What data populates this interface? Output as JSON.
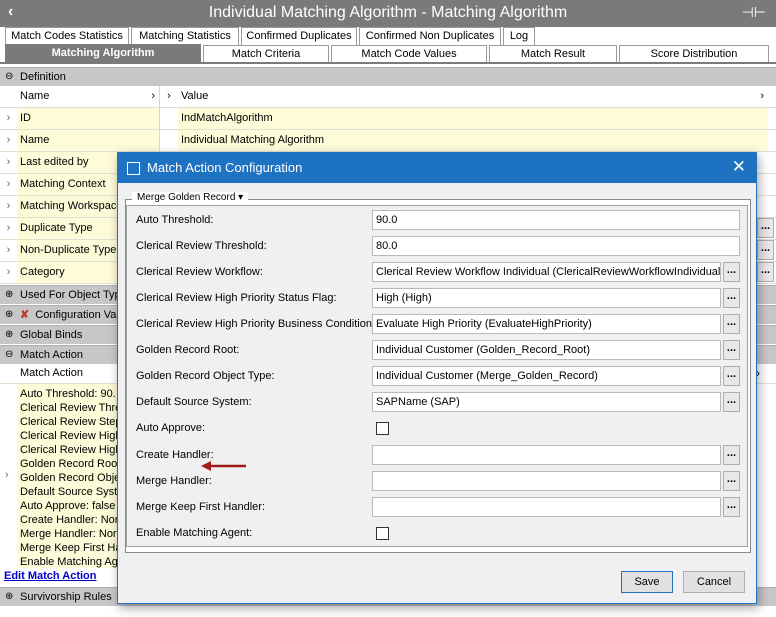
{
  "window": {
    "title": "Individual Matching Algorithm - Matching Algorithm",
    "back_icon": "‹",
    "pin_icon": "⊣⊢"
  },
  "tabs_row1": [
    "Match Codes Statistics",
    "Matching Statistics",
    "Confirmed Duplicates",
    "Confirmed Non Duplicates",
    "Log"
  ],
  "tabs_row2": [
    "Matching Algorithm",
    "Match Criteria",
    "Match Code Values",
    "Match Result",
    "Score Distribution"
  ],
  "definition": {
    "header": "Definition",
    "col_name": "Name",
    "col_value": "Value",
    "rows": [
      {
        "name": "ID",
        "value": "IndMatchAlgorithm"
      },
      {
        "name": "Name",
        "value": "Individual Matching Algorithm"
      },
      {
        "name": "Last edited by",
        "value": ""
      },
      {
        "name": "Matching Context",
        "value": ""
      },
      {
        "name": "Matching Workspace",
        "value": ""
      },
      {
        "name": "Duplicate Type",
        "value": ""
      },
      {
        "name": "Non-Duplicate Type",
        "value": ""
      },
      {
        "name": "Category",
        "value": ""
      }
    ]
  },
  "sections": {
    "used_for": "Used For Object Type",
    "configuration": "Configuration Va",
    "global_binds": "Global Binds",
    "match_action": "Match Action",
    "survivorship": "Survivorship Rules"
  },
  "match_action": {
    "col_header": "Match Action",
    "lines": [
      "Auto Threshold: 90.",
      "Clerical Review Thre",
      "Clerical Review Step",
      "Clerical Review High",
      "Clerical Review High",
      "Golden Record Root",
      "Golden Record Obje",
      "Default Source Syst",
      "Auto Approve: false",
      "Create Handler: Nor",
      "Merge Handler: Non",
      "Merge Keep First Ha",
      "Enable Matching Age"
    ],
    "edit_link": "Edit Match Action"
  },
  "dialog": {
    "title": "Match Action Configuration",
    "close_icon": "✕",
    "group": "Merge Golden Record",
    "fields": [
      {
        "label": "Auto Threshold:",
        "value": "90.0",
        "type": "text",
        "button": false
      },
      {
        "label": "Clerical Review Threshold:",
        "value": "80.0",
        "type": "text",
        "button": false
      },
      {
        "label": "Clerical Review Workflow:",
        "value": "Clerical Review Workflow Individual (ClericalReviewWorkflowIndividual)",
        "type": "text",
        "button": true
      },
      {
        "label": "Clerical Review High Priority Status Flag:",
        "value": "High (High)",
        "type": "text",
        "button": true
      },
      {
        "label": "Clerical Review High Priority Business Condition:",
        "value": "Evaluate High Priority (EvaluateHighPriority)",
        "type": "text",
        "button": true
      },
      {
        "label": "Golden Record Root:",
        "value": "Individual Customer (Golden_Record_Root)",
        "type": "text",
        "button": true
      },
      {
        "label": "Golden Record Object Type:",
        "value": "Individual Customer (Merge_Golden_Record)",
        "type": "text",
        "button": true
      },
      {
        "label": "Default Source System:",
        "value": "SAPName (SAP)",
        "type": "text",
        "button": true
      },
      {
        "label": "Auto Approve:",
        "value": "",
        "type": "checkbox",
        "button": false
      },
      {
        "label": "Create Handler:",
        "value": "",
        "type": "text",
        "button": true
      },
      {
        "label": "Merge Handler:",
        "value": "",
        "type": "text",
        "button": true
      },
      {
        "label": "Merge Keep First Handler:",
        "value": "",
        "type": "text",
        "button": true
      },
      {
        "label": "Enable Matching Agent:",
        "value": "",
        "type": "checkbox",
        "button": false
      }
    ],
    "ellipsis": "...",
    "save": "Save",
    "cancel": "Cancel"
  }
}
